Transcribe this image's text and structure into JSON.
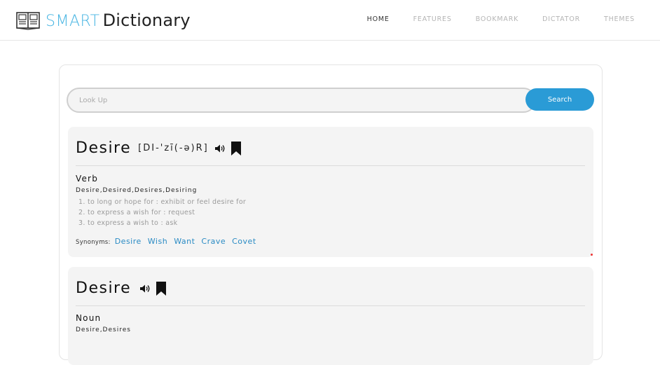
{
  "header": {
    "brand_smart": "SMART",
    "brand_dictionary": "Dictionary",
    "nav": [
      {
        "label": "HOME"
      },
      {
        "label": "FEATURES"
      },
      {
        "label": "BOOKMARK"
      },
      {
        "label": "DICTATOR"
      },
      {
        "label": "THEMES"
      }
    ],
    "active_nav": "HOME"
  },
  "search": {
    "placeholder": "Look Up",
    "value": "",
    "button_label": "Search"
  },
  "entries": [
    {
      "word": "Desire",
      "pronunciation": "[DI-'zī(-ə)R]",
      "part_of_speech": "Verb",
      "forms": "Desire,Desired,Desires,Desiring",
      "definitions": [
        "to long or hope for : exhibit or feel desire for",
        "to express a wish for : request",
        "to express a wish to : ask"
      ],
      "synonyms_label": "Synonyms:",
      "synonyms": [
        "Desire",
        "Wish",
        "Want",
        "Crave",
        "Covet"
      ]
    },
    {
      "word": "Desire",
      "part_of_speech": "Noun",
      "forms": "Desire,Desires"
    }
  ],
  "icons": {
    "logo": "book-icon",
    "speaker": "speaker-icon",
    "bookmark": "bookmark-icon"
  },
  "colors": {
    "accent": "#2a9bd6",
    "brand_smart": "#4ab6e3",
    "synonym": "#2a8bc4",
    "entry_bg": "#f4f4f4"
  }
}
